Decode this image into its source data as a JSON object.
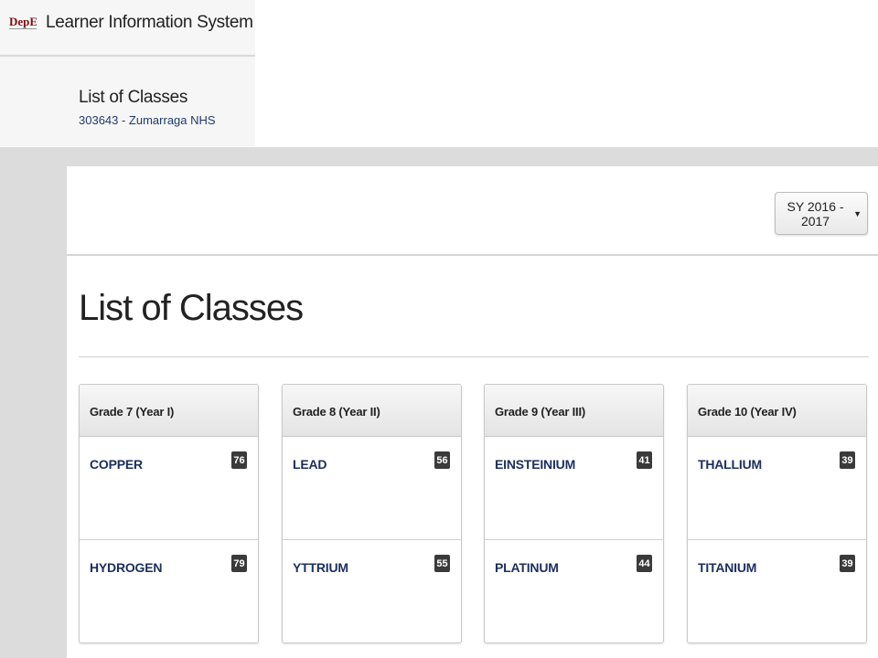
{
  "app": {
    "title": "Learner Information System",
    "logo_text": "DepED"
  },
  "subheader": {
    "title": "List of Classes",
    "school": "303643 - Zumarraga NHS"
  },
  "toolbar": {
    "school_year": "SY 2016 - 2017"
  },
  "main": {
    "title": "List of Classes",
    "grades": [
      {
        "label": "Grade 7 (Year I)",
        "classes": [
          {
            "name": "COPPER",
            "count": "76"
          },
          {
            "name": "HYDROGEN",
            "count": "79"
          }
        ]
      },
      {
        "label": "Grade 8 (Year II)",
        "classes": [
          {
            "name": "LEAD",
            "count": "56"
          },
          {
            "name": "YTTRIUM",
            "count": "55"
          }
        ]
      },
      {
        "label": "Grade 9 (Year III)",
        "classes": [
          {
            "name": "EINSTEINIUM",
            "count": "41"
          },
          {
            "name": "PLATINUM",
            "count": "44"
          }
        ]
      },
      {
        "label": "Grade 10 (Year IV)",
        "classes": [
          {
            "name": "THALLIUM",
            "count": "39"
          },
          {
            "name": "TITANIUM",
            "count": "39"
          }
        ]
      }
    ]
  },
  "colors": {
    "link": "#1b2e5e",
    "badge": "#3a3a3a",
    "background_gray": "#dcdcdc"
  }
}
